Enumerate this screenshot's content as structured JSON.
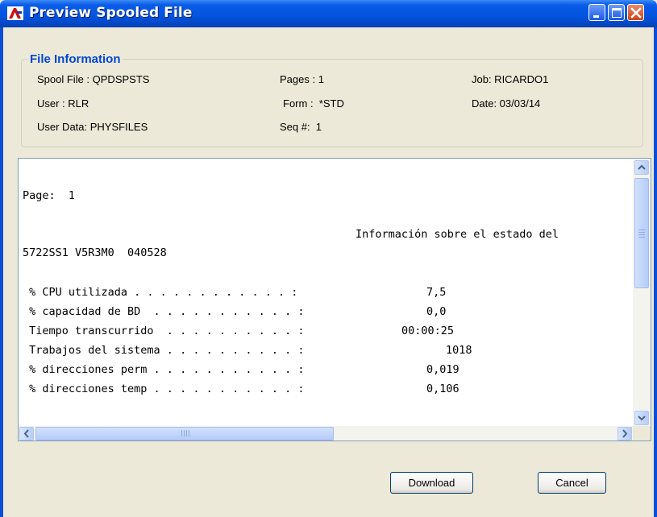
{
  "window": {
    "title": "Preview Spooled File"
  },
  "file_information": {
    "legend": "File Information",
    "spool_file": "Spool File : QPDSPSTS",
    "pages": "Pages : 1",
    "job": "Job: RICARDO1",
    "user": "User : RLR",
    "form": "Form :  *STD",
    "date": "Date: 03/03/14",
    "user_data": "User Data: PHYSFILES",
    "seq": "Seq #:  1"
  },
  "spool_text": {
    "page_line": "Page:  1",
    "header_line": "Información sobre el estado del",
    "version_line": "5722SS1 V5R3M0  040528",
    "rows": [
      {
        "label": " % CPU utilizada . . . . . . . . . . . . :",
        "value": "7,5"
      },
      {
        "label": " % capacidad de BD  . . . . . . . . . . . :",
        "value": "0,0"
      },
      {
        "label": " Tiempo transcurrido  . . . . . . . . . . :",
        "value": "00:00:25"
      },
      {
        "label": " Trabajos del sistema . . . . . . . . . . :",
        "value": "1018"
      },
      {
        "label": " % direcciones perm . . . . . . . . . . . :",
        "value": "0,019"
      },
      {
        "label": " % direcciones temp . . . . . . . . . . . :",
        "value": "0,106"
      }
    ]
  },
  "buttons": {
    "download": "Download",
    "cancel": "Cancel"
  },
  "colors": {
    "titlebar": "#0355e0",
    "legend": "#0046d5",
    "window_bg": "#ece9d8"
  },
  "icons": {
    "app": "java-app-icon",
    "minimize": "minimize-icon",
    "maximize": "maximize-icon",
    "close": "close-icon"
  }
}
